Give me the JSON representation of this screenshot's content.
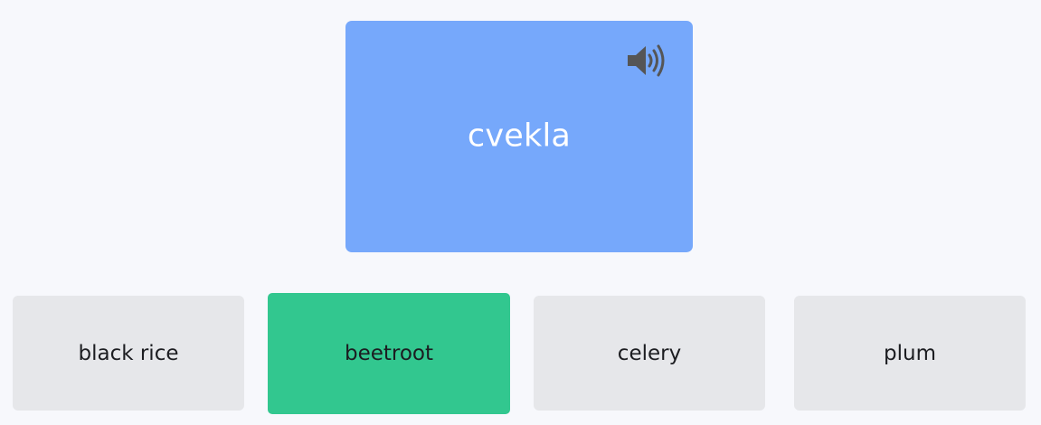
{
  "card": {
    "word": "cvekla",
    "audio_icon": "speaker-volume-icon"
  },
  "options": [
    {
      "label": "black rice",
      "selected": false
    },
    {
      "label": "beetroot",
      "selected": true
    },
    {
      "label": "celery",
      "selected": false
    },
    {
      "label": "plum",
      "selected": false
    }
  ],
  "colors": {
    "background": "#f7f8fc",
    "card": "#76a8fb",
    "card_text": "#ffffff",
    "option": "#e6e7ea",
    "selected_option": "#32c78f",
    "icon": "#555555"
  }
}
